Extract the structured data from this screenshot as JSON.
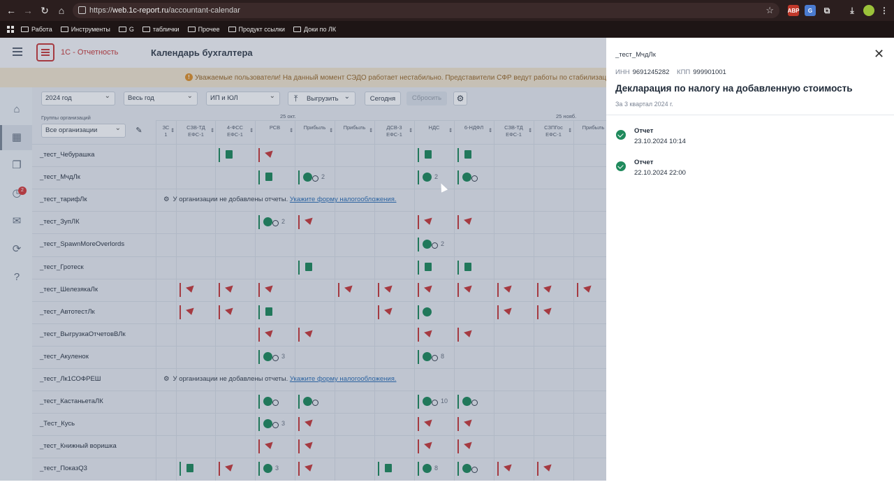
{
  "browser": {
    "url_prefix": "https://",
    "url_host": "web.1c-report.ru",
    "url_path": "/accountant-calendar",
    "bookmarks": [
      "Работа",
      "Инструменты",
      "G",
      "таблички",
      "Прочее",
      "Продукт ссылки",
      "Доки по ЛК"
    ]
  },
  "app": {
    "logo_text": "1С - Отчетность",
    "title": "Календарь бухгалтера",
    "banner": "Уважаемые пользователи! На данный момент СЭДО работает нестабильно. Представители СФР ведут работы по стабилизации, то",
    "sidebar_badge": "2"
  },
  "toolbar": {
    "year": "2024 год",
    "period": "Весь год",
    "org_type": "ИП и ЮЛ",
    "export": "Выгрузить",
    "today": "Сегодня",
    "reset": "Сбросить",
    "groups_label": "Группы организаций",
    "groups_value": "Все организации"
  },
  "grid": {
    "date_labels": [
      "25 окт.",
      "25 нояб."
    ],
    "columns": [
      "ЗС\n1",
      "СЗВ-ТД\nЕФС-1",
      "4-ФСС\nЕФС-1",
      "РСВ",
      "Прибыль",
      "Прибыль",
      "ДСВ-3\nЕФС-1",
      "НДС",
      "6-НДФЛ",
      "СЗВ-ТД\nЕФС-1",
      "СЗПГос\nЕФС-1",
      "Прибыль"
    ],
    "notice_text": "У организации не добавлены отчеты.",
    "notice_link": "Укажите форму налогообложения.",
    "rows": [
      {
        "name": "_тест_Чебурашка",
        "cells": [
          "",
          "",
          "doc",
          "flag",
          "",
          "",
          "",
          "doc",
          "doc",
          "",
          "",
          ""
        ]
      },
      {
        "name": "_тест_МчдЛк",
        "cells": [
          "",
          "",
          "",
          "doc",
          "okc:2",
          "",
          "",
          "ok:2",
          "okc",
          "",
          "",
          ""
        ]
      },
      {
        "name": "_тест_тарифЛк",
        "notice": true
      },
      {
        "name": "_тест_ЗупЛК",
        "cells": [
          "",
          "",
          "",
          "okc:2",
          "flag",
          "",
          "",
          "flag",
          "flag",
          "",
          "",
          ""
        ]
      },
      {
        "name": "_тест_SpawnMoreOverlords",
        "cells": [
          "",
          "",
          "",
          "",
          "",
          "",
          "",
          "okc:2",
          "",
          "",
          "",
          ""
        ]
      },
      {
        "name": "_тест_Гротеск",
        "cells": [
          "",
          "",
          "",
          "",
          "doc",
          "",
          "",
          "doc",
          "doc",
          "",
          "",
          ""
        ]
      },
      {
        "name": "_тест_ШелезякаЛк",
        "cells": [
          "",
          "flag",
          "flag",
          "flag",
          "",
          "flag",
          "flag",
          "flag",
          "flag",
          "flag",
          "flag",
          "flag"
        ]
      },
      {
        "name": "_тест_АвтотестЛк",
        "cells": [
          "",
          "flag",
          "flag",
          "doc",
          "",
          "",
          "flag",
          "ok",
          "",
          "flag",
          "flag",
          ""
        ]
      },
      {
        "name": "_тест_ВыгрузкаОтчетовВЛк",
        "cells": [
          "",
          "",
          "",
          "flag",
          "flag",
          "",
          "",
          "flag",
          "flag",
          "",
          "",
          ""
        ]
      },
      {
        "name": "_тест_Акуленок",
        "cells": [
          "",
          "",
          "",
          "okc:3",
          "",
          "",
          "",
          "okc:8",
          "",
          "",
          "",
          ""
        ]
      },
      {
        "name": "_тест_Лк1СОФРЕШ",
        "notice": true
      },
      {
        "name": "_тест_КастаньетаЛК",
        "cells": [
          "",
          "",
          "",
          "okc",
          "okc",
          "",
          "",
          "okc:10",
          "okc",
          "",
          "",
          ""
        ]
      },
      {
        "name": "_Тест_Кусь",
        "cells": [
          "",
          "",
          "",
          "okc:3",
          "flag",
          "",
          "",
          "flag",
          "flag",
          "",
          "",
          ""
        ]
      },
      {
        "name": "_тест_Книжный воришка",
        "cells": [
          "",
          "",
          "",
          "flag",
          "flag",
          "",
          "",
          "flag",
          "flag",
          "",
          "",
          ""
        ]
      },
      {
        "name": "_тест_ПоказQ3",
        "cells": [
          "",
          "doc",
          "flag",
          "ok:3",
          "flag",
          "",
          "doc",
          "ok:8",
          "okc",
          "flag",
          "flag",
          ""
        ]
      }
    ]
  },
  "panel": {
    "org": "_тест_МчдЛк",
    "inn_label": "ИНН",
    "inn": "9691245282",
    "kpp_label": "КПП",
    "kpp": "999901001",
    "title": "Декларация по налогу на добавленную стоимость",
    "subtitle": "За 3 квартал 2024 г.",
    "reports": [
      {
        "title": "Отчет",
        "date": "23.10.2024 10:14"
      },
      {
        "title": "Отчет",
        "date": "22.10.2024 22:00"
      }
    ]
  },
  "colors": {
    "accent_red": "#c83a3a",
    "ok_green": "#1f8a5c",
    "panel_bg": "#ffffff"
  }
}
